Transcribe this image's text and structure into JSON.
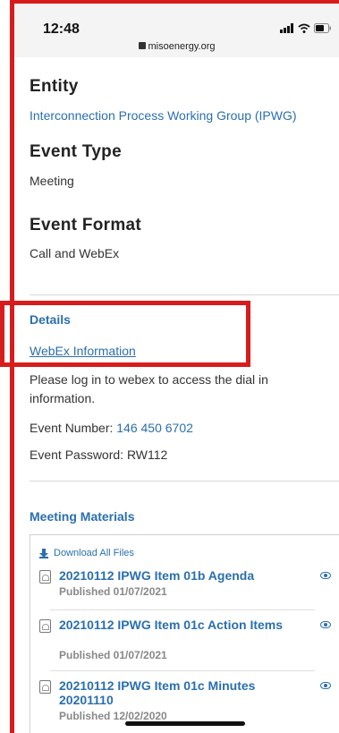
{
  "status_bar": {
    "time": "12:48",
    "url": "misoenergy.org"
  },
  "entity": {
    "heading": "Entity",
    "value": "Interconnection Process Working Group (IPWG)"
  },
  "event_type": {
    "heading": "Event Type",
    "value": "Meeting"
  },
  "event_format": {
    "heading": "Event Format",
    "value": "Call and WebEx"
  },
  "details": {
    "heading": "Details",
    "webex_link": "WebEx Information",
    "text": "Please log in to webex to access the dial in information.",
    "event_number_label": "Event Number:",
    "event_number": "146 450 6702",
    "event_password_label": "Event Password:",
    "event_password": "RW112"
  },
  "materials": {
    "heading": "Meeting Materials",
    "download_all": "Download All Files",
    "items": [
      {
        "title": "20210112 IPWG Item 01b Agenda",
        "published": "Published 01/07/2021"
      },
      {
        "title": "20210112 IPWG Item 01c Action Items",
        "published": "Published 01/07/2021"
      },
      {
        "title": "20210112 IPWG Item 01c Minutes 20201110",
        "published": "Published 12/02/2020"
      }
    ]
  },
  "icons": [
    "lock-icon",
    "signal-icon",
    "wifi-icon",
    "battery-icon",
    "download-icon",
    "pdf-icon",
    "eye-icon"
  ],
  "colors": {
    "link": "#2a6fae",
    "annotation_red": "#d81c1c",
    "status_bar_bg": "#f4f4f4"
  }
}
